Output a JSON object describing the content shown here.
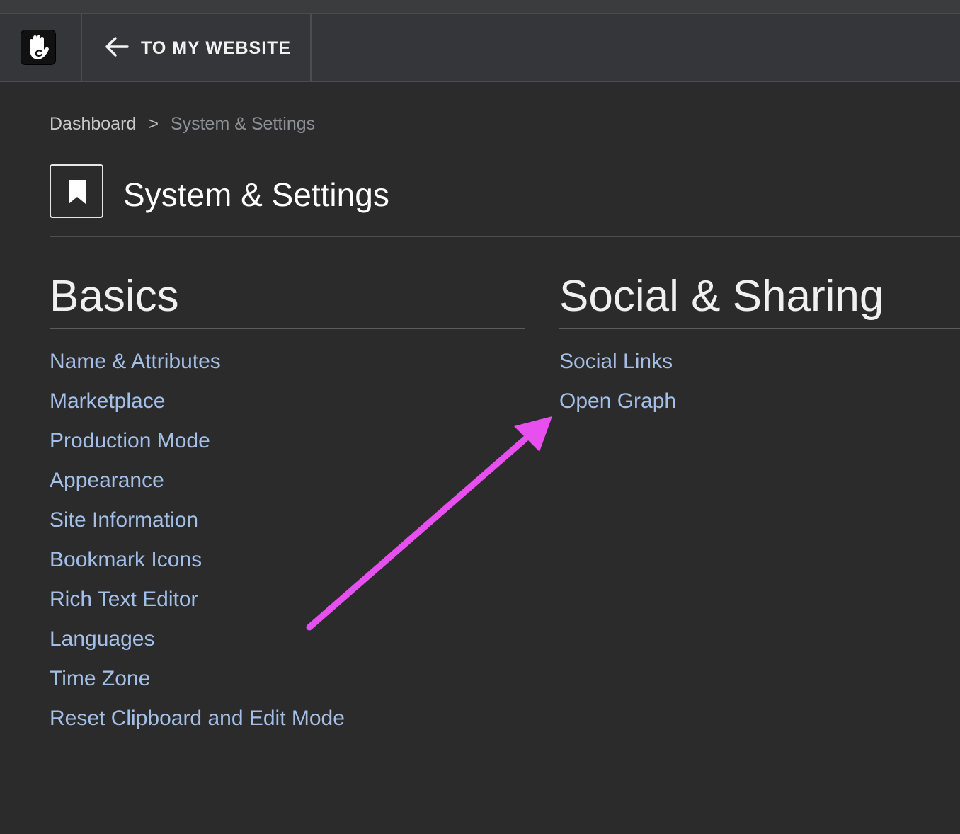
{
  "toolbar": {
    "logo_icon": "concrete-hand-icon",
    "back_icon": "arrow-left-icon",
    "back_label": "TO MY WEBSITE"
  },
  "breadcrumb": {
    "items": [
      "Dashboard",
      "System & Settings"
    ],
    "separator": ">"
  },
  "page": {
    "icon": "bookmark-icon",
    "title": "System & Settings"
  },
  "sections": {
    "basics": {
      "heading": "Basics",
      "links": [
        "Name & Attributes",
        "Marketplace",
        "Production Mode",
        "Appearance",
        "Site Information",
        "Bookmark Icons",
        "Rich Text Editor",
        "Languages",
        "Time Zone",
        "Reset Clipboard and Edit Mode"
      ]
    },
    "social": {
      "heading": "Social & Sharing",
      "links": [
        "Social Links",
        "Open Graph"
      ]
    }
  },
  "annotation": {
    "type": "arrow",
    "color": "#e84fef",
    "points_to": "Open Graph"
  },
  "colors": {
    "background": "#2b2b2c",
    "toolbar": "#343639",
    "link": "#a3bfe8",
    "text": "#ffffff"
  }
}
